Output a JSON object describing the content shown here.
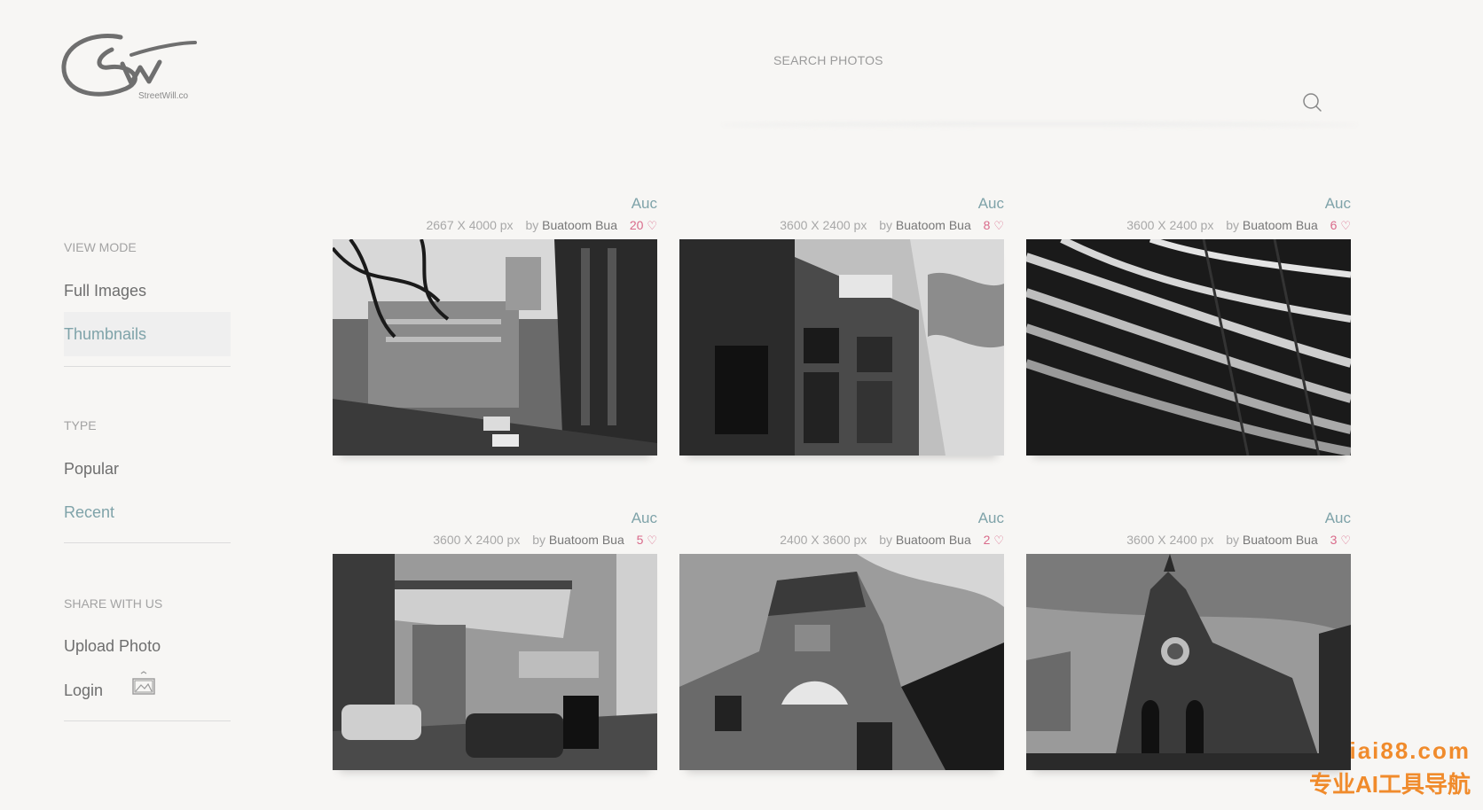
{
  "logo": {
    "text": "StreetWill.co"
  },
  "search": {
    "label": "SEARCH PHOTOS"
  },
  "sidebar": {
    "view_mode": {
      "label": "VIEW MODE",
      "items": [
        {
          "label": "Full Images",
          "active": false
        },
        {
          "label": "Thumbnails",
          "active": true
        }
      ]
    },
    "type": {
      "label": "TYPE",
      "items": [
        {
          "label": "Popular"
        },
        {
          "label": "Recent"
        }
      ]
    },
    "share": {
      "label": "SHARE WITH US",
      "items": [
        {
          "label": "Upload Photo"
        },
        {
          "label": "Login"
        }
      ]
    }
  },
  "photos": [
    {
      "location": "Auc",
      "dimensions": "2667 X 4000 px",
      "by": "by",
      "author": "Buatoom Bua",
      "likes": "20"
    },
    {
      "location": "Auc",
      "dimensions": "3600 X 2400 px",
      "by": "by",
      "author": "Buatoom Bua",
      "likes": "8"
    },
    {
      "location": "Auc",
      "dimensions": "3600 X 2400 px",
      "by": "by",
      "author": "Buatoom Bua",
      "likes": "6"
    },
    {
      "location": "Auc",
      "dimensions": "3600 X 2400 px",
      "by": "by",
      "author": "Buatoom Bua",
      "likes": "5"
    },
    {
      "location": "Auc",
      "dimensions": "2400 X 3600 px",
      "by": "by",
      "author": "Buatoom Bua",
      "likes": "2"
    },
    {
      "location": "Auc",
      "dimensions": "3600 X 2400 px",
      "by": "by",
      "author": "Buatoom Bua",
      "likes": "3"
    }
  ],
  "icons": {
    "search": "search-icon",
    "heart": "heart-icon",
    "upload": "image-upload-icon"
  },
  "colors": {
    "accent": "#7fa3a9",
    "likes": "#d96a8a",
    "background": "#f7f6f4"
  },
  "watermark": {
    "line1": "iai88.com",
    "line2": "专业AI工具导航"
  }
}
